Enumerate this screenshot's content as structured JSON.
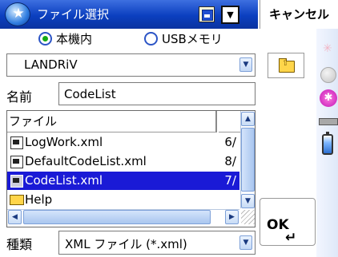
{
  "dialog": {
    "title": "ファイル選択",
    "cancel_label": "キャンセル",
    "ok_label": "OK",
    "enter_glyph": "↵"
  },
  "location": {
    "options": [
      {
        "label": "本機内",
        "selected": true
      },
      {
        "label": "USBメモリ",
        "selected": false
      }
    ],
    "folder_value": "LANDRiV"
  },
  "name_field": {
    "label": "名前",
    "value": "CodeList"
  },
  "file_list": {
    "column_header": "ファイル",
    "rows": [
      {
        "name": "LogWork.xml",
        "size": "6/",
        "type": "file",
        "selected": false
      },
      {
        "name": "DefaultCodeList.xml",
        "size": "8/",
        "type": "file",
        "selected": false
      },
      {
        "name": "CodeList.xml",
        "size": "7/",
        "type": "file",
        "selected": true
      },
      {
        "name": "Help",
        "size": "",
        "type": "folder",
        "selected": false
      }
    ]
  },
  "type_field": {
    "label": "種類",
    "value": "XML ファイル (*.xml)"
  },
  "icons": {
    "app": "globe-star-icon",
    "tray": [
      "spark-icon",
      "circle-icon",
      "star-icon",
      "keyboard-icon",
      "battery-icon"
    ]
  },
  "colors": {
    "titlebar": "#0b3fbf",
    "selection": "#1a1ad6",
    "radio_selected": "#14aa14"
  }
}
